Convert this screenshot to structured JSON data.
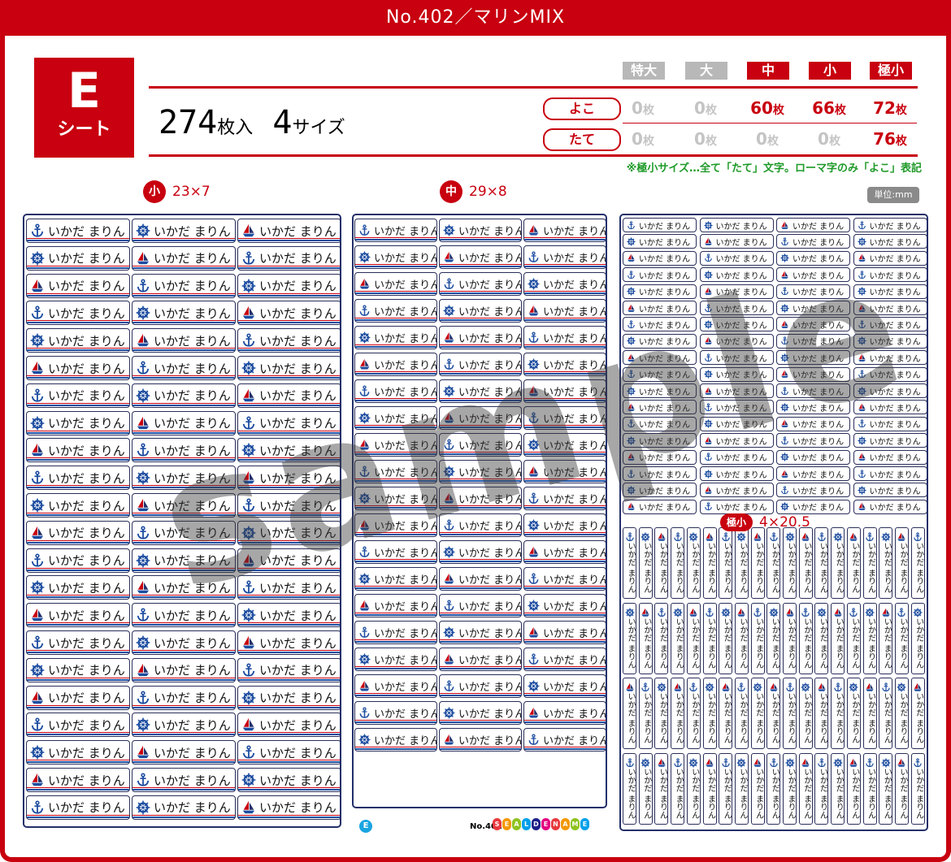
{
  "title": "No.402／マリンMIX",
  "sheet": {
    "letter": "E",
    "word": "シート"
  },
  "count": {
    "number": "274",
    "unit": "枚入",
    "sizes": "4",
    "sizes_unit": "サイズ"
  },
  "size_headers": [
    {
      "label": "特大",
      "active": false
    },
    {
      "label": "大",
      "active": false
    },
    {
      "label": "中",
      "active": true
    },
    {
      "label": "小",
      "active": true
    },
    {
      "label": "極小",
      "active": true
    }
  ],
  "orientations": [
    {
      "label": "よこ",
      "counts": [
        {
          "n": "0",
          "u": "枚",
          "active": false
        },
        {
          "n": "0",
          "u": "枚",
          "active": false
        },
        {
          "n": "60",
          "u": "枚",
          "active": true
        },
        {
          "n": "66",
          "u": "枚",
          "active": true
        },
        {
          "n": "72",
          "u": "枚",
          "active": true
        }
      ]
    },
    {
      "label": "たて",
      "counts": [
        {
          "n": "0",
          "u": "枚",
          "active": false
        },
        {
          "n": "0",
          "u": "枚",
          "active": false
        },
        {
          "n": "0",
          "u": "枚",
          "active": false
        },
        {
          "n": "0",
          "u": "枚",
          "active": false
        },
        {
          "n": "76",
          "u": "枚",
          "active": true
        }
      ]
    }
  ],
  "note": "※極小サイズ…全て「たて」文字。ローマ字のみ「よこ」表記",
  "sections": {
    "small": {
      "badge": "小",
      "dims": "23×7"
    },
    "medium": {
      "badge": "中",
      "dims": "29×8"
    },
    "tiny": {
      "badge": "極小",
      "dims": "4×20.5"
    }
  },
  "unit_label": "単位:mm",
  "label_name": "いかだ まりん",
  "label_name_vertical": "いかだ まりん",
  "watermark": "sample",
  "footer": {
    "badge": "E",
    "number": "No.402",
    "brand": "SEALDENAME"
  },
  "icons": [
    "anchor-icon",
    "ship-wheel-icon",
    "sailboat-icon"
  ],
  "colors": {
    "brand_red": "#c8000f",
    "navy": "#24306a",
    "blue": "#1d4da0",
    "note_green": "#1e9a28"
  }
}
